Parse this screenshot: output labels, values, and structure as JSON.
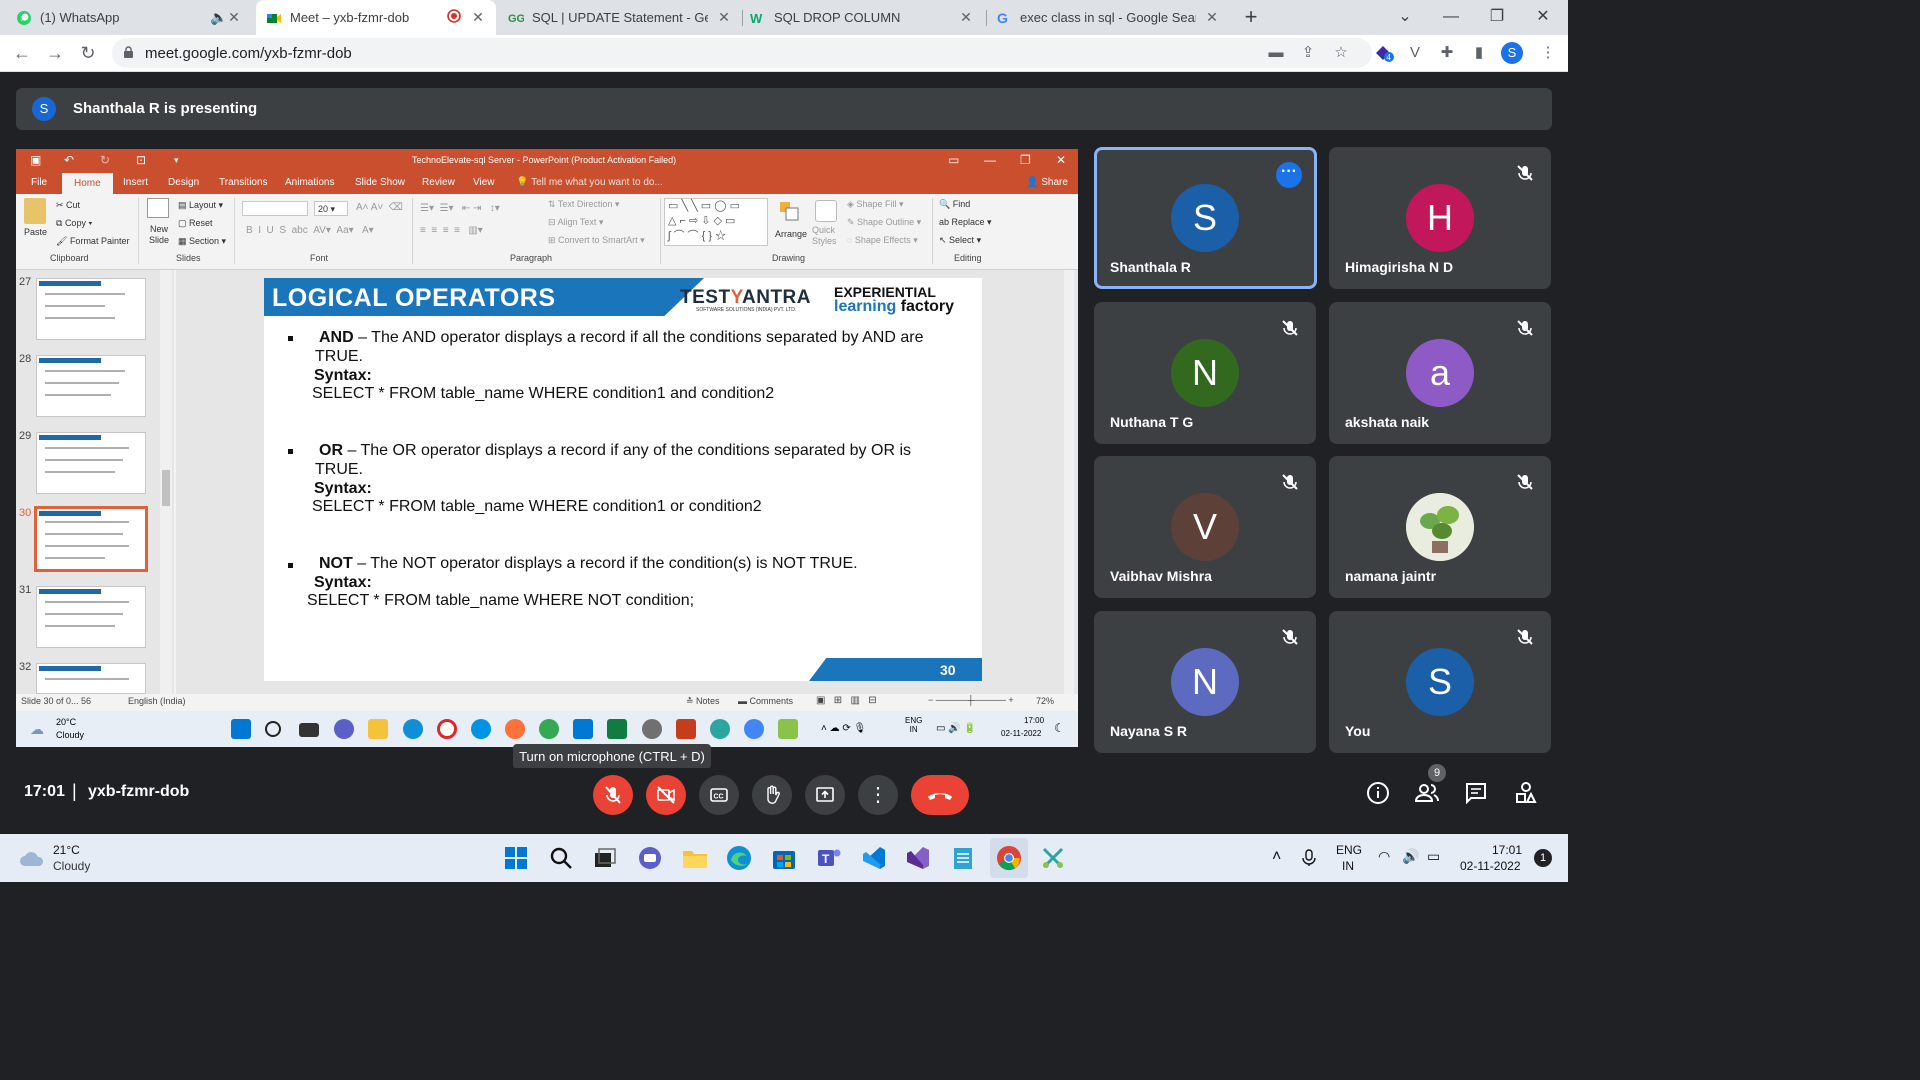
{
  "browser": {
    "tabs": [
      {
        "title": "(1) WhatsApp",
        "icon": "whatsapp-icon"
      },
      {
        "title": "Meet – yxb-fzmr-dob",
        "icon": "meet-icon"
      },
      {
        "title": "SQL | UPDATE Statement - Geeks",
        "icon": "geeksforgeeks-icon"
      },
      {
        "title": "SQL DROP COLUMN",
        "icon": "w3schools-icon"
      },
      {
        "title": "exec class in sql - Google Search",
        "icon": "google-icon"
      }
    ],
    "new_tab": "+",
    "url": "meet.google.com/yxb-fzmr-dob",
    "profile_initial": "S",
    "extension_badge": "4"
  },
  "meet": {
    "presenting_avatar": "S",
    "presenting_text": "Shanthala R is presenting",
    "time": "17:01",
    "meeting_code": "yxb-fzmr-dob",
    "tooltip": "Turn on microphone (CTRL + D)",
    "people_count": "9",
    "participants": [
      {
        "name": "Shanthala R",
        "initial": "S",
        "color": "#1a5fa8"
      },
      {
        "name": "Himagirisha N D",
        "initial": "H",
        "color": "#c2185b"
      },
      {
        "name": "Nuthana T G",
        "initial": "N",
        "color": "#33691e"
      },
      {
        "name": "akshata naik",
        "initial": "a",
        "color": "#8e5bc6"
      },
      {
        "name": "Vaibhav Mishra",
        "initial": "V",
        "color": "#5d4037"
      },
      {
        "name": "namana jaintr",
        "initial": "",
        "color": "#7cb342"
      },
      {
        "name": "Nayana S R",
        "initial": "N",
        "color": "#5c6bc0"
      },
      {
        "name": "You",
        "initial": "S",
        "color": "#1a5fa8"
      }
    ]
  },
  "ppt": {
    "window_title": "TechnoElevate-sql Server - PowerPoint (Product Activation Failed)",
    "tabs": [
      "File",
      "Home",
      "Insert",
      "Design",
      "Transitions",
      "Animations",
      "Slide Show",
      "Review",
      "View"
    ],
    "tell_me": "Tell me what you want to do...",
    "share": "Share",
    "ribbon": {
      "paste": "Paste",
      "cut": "Cut",
      "copy": "Copy",
      "format_painter": "Format Painter",
      "clipboard": "Clipboard",
      "new_slide": "New Slide",
      "layout": "Layout",
      "reset": "Reset",
      "section": "Section",
      "slides": "Slides",
      "font": "Font",
      "font_size": "20",
      "text_direction": "Text Direction",
      "align_text": "Align Text",
      "convert_smartart": "Convert to SmartArt",
      "paragraph": "Paragraph",
      "arrange": "Arrange",
      "quick_styles": "Quick Styles",
      "shape_fill": "Shape Fill",
      "shape_outline": "Shape Outline",
      "shape_effects": "Shape Effects",
      "drawing": "Drawing",
      "find": "Find",
      "replace": "Replace",
      "select": "Select",
      "editing": "Editing"
    },
    "thumb_numbers": [
      "27",
      "28",
      "29",
      "30",
      "31",
      "32"
    ],
    "slide": {
      "title": "LOGICAL OPERATORS",
      "logo_testyantra": "TESTYANTRA",
      "logo_test": "TEST",
      "logo_y": "Y",
      "logo_antra": "ANTRA",
      "logo_sub": "SOFTWARE SOLUTIONS (INDIA) PVT. LTD.",
      "logo_exp1": "EXPERIENTIAL",
      "logo_exp2a": "learning",
      "logo_exp2b": "factory",
      "and_kw": "AND",
      "and_desc": " –  The AND operator displays a record if all the conditions separated by AND are",
      "and_desc2": "TRUE.",
      "syntax": "Syntax:",
      "and_sql": "SELECT * FROM table_name WHERE condition1 and condition2",
      "or_kw": "OR",
      "or_desc": "  – The OR operator displays a record if any of the conditions separated by OR is",
      "or_desc2": "TRUE.",
      "or_sql": "SELECT * FROM table_name WHERE condition1 or condition2",
      "not_kw": "NOT",
      "not_desc": " –  The NOT operator displays a record if the condition(s) is NOT TRUE.",
      "not_sql": "SELECT * FROM table_name WHERE NOT condition;",
      "page_number": "30"
    },
    "status": {
      "slide_of": "Slide 30 of 0... 56",
      "language": "English (India)",
      "notes": "Notes",
      "comments": "Comments",
      "zoom": "72%"
    },
    "inner_taskbar": {
      "temp": "20°C",
      "weather": "Cloudy",
      "lang1": "ENG",
      "lang2": "IN",
      "time": "17:00",
      "date": "02-11-2022"
    }
  },
  "taskbar": {
    "temp": "21°C",
    "weather": "Cloudy",
    "lang1": "ENG",
    "lang2": "IN",
    "time": "17:01",
    "date": "02-11-2022",
    "notif": "1"
  }
}
